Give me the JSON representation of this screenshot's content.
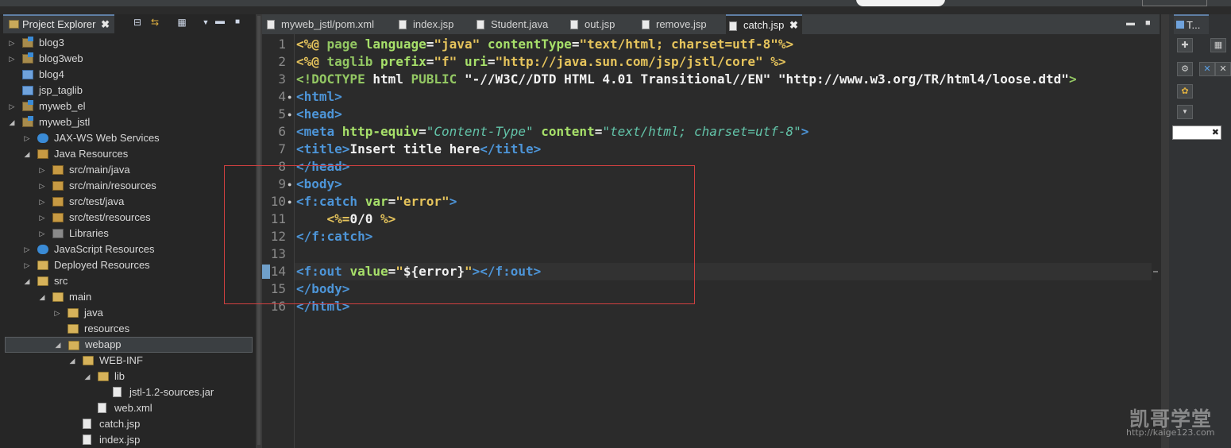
{
  "explorer": {
    "title": "Project Explorer",
    "close_glyph": "✖",
    "toolbar_icons": [
      "collapse-all-icon",
      "link-editor-icon",
      "view-menu-icon",
      "minimize-icon",
      "maximize-icon"
    ],
    "tree": [
      {
        "label": "blog3",
        "depth": 0,
        "arrow": "▷",
        "icon": "project"
      },
      {
        "label": "blog3web",
        "depth": 0,
        "arrow": "▷",
        "icon": "project"
      },
      {
        "label": "blog4",
        "depth": 0,
        "arrow": "",
        "icon": "folder-blue"
      },
      {
        "label": "jsp_taglib",
        "depth": 0,
        "arrow": "",
        "icon": "folder-blue"
      },
      {
        "label": "myweb_el",
        "depth": 0,
        "arrow": "▷",
        "icon": "project"
      },
      {
        "label": "myweb_jstl",
        "depth": 0,
        "arrow": "◢",
        "icon": "project"
      },
      {
        "label": "JAX-WS Web Services",
        "depth": 1,
        "arrow": "▷",
        "icon": "webservice"
      },
      {
        "label": "Java Resources",
        "depth": 1,
        "arrow": "◢",
        "icon": "package"
      },
      {
        "label": "src/main/java",
        "depth": 2,
        "arrow": "▷",
        "icon": "package"
      },
      {
        "label": "src/main/resources",
        "depth": 2,
        "arrow": "▷",
        "icon": "package"
      },
      {
        "label": "src/test/java",
        "depth": 2,
        "arrow": "▷",
        "icon": "package"
      },
      {
        "label": "src/test/resources",
        "depth": 2,
        "arrow": "▷",
        "icon": "package"
      },
      {
        "label": "Libraries",
        "depth": 2,
        "arrow": "▷",
        "icon": "library"
      },
      {
        "label": "JavaScript Resources",
        "depth": 1,
        "arrow": "▷",
        "icon": "webservice"
      },
      {
        "label": "Deployed Resources",
        "depth": 1,
        "arrow": "▷",
        "icon": "folder"
      },
      {
        "label": "src",
        "depth": 1,
        "arrow": "◢",
        "icon": "folder"
      },
      {
        "label": "main",
        "depth": 2,
        "arrow": "◢",
        "icon": "folder"
      },
      {
        "label": "java",
        "depth": 3,
        "arrow": "▷",
        "icon": "folder"
      },
      {
        "label": "resources",
        "depth": 3,
        "arrow": "",
        "icon": "folder"
      },
      {
        "label": "webapp",
        "depth": 3,
        "arrow": "◢",
        "icon": "folder",
        "selected": true
      },
      {
        "label": "WEB-INF",
        "depth": 4,
        "arrow": "◢",
        "icon": "folder"
      },
      {
        "label": "lib",
        "depth": 5,
        "arrow": "◢",
        "icon": "folder"
      },
      {
        "label": "jstl-1.2-sources.jar",
        "depth": 6,
        "arrow": "",
        "icon": "file"
      },
      {
        "label": "web.xml",
        "depth": 5,
        "arrow": "",
        "icon": "file"
      },
      {
        "label": "catch.jsp",
        "depth": 4,
        "arrow": "",
        "icon": "file"
      },
      {
        "label": "index.jsp",
        "depth": 4,
        "arrow": "",
        "icon": "file"
      }
    ]
  },
  "editor": {
    "tabs": [
      {
        "label": "myweb_jstl/pom.xml",
        "active": false
      },
      {
        "label": "index.jsp",
        "active": false
      },
      {
        "label": "Student.java",
        "active": false
      },
      {
        "label": "out.jsp",
        "active": false
      },
      {
        "label": "remove.jsp",
        "active": false
      },
      {
        "label": "catch.jsp",
        "active": true
      }
    ],
    "close_glyph": "✖",
    "minimize_glyph": "▬",
    "maximize_glyph": "■",
    "current_line": 14,
    "lines": [
      {
        "n": "1",
        "tokens": [
          [
            "c-dir",
            "<%@ "
          ],
          [
            "c-kw",
            "page "
          ],
          [
            "c-attr",
            "language"
          ],
          [
            "c-text",
            "="
          ],
          [
            "c-str",
            "\"java\" "
          ],
          [
            "c-attr",
            "contentType"
          ],
          [
            "c-text",
            "="
          ],
          [
            "c-str",
            "\"text/html; charset=utf-8\""
          ],
          [
            "c-dir",
            "%>"
          ]
        ]
      },
      {
        "n": "2",
        "tokens": [
          [
            "c-dir",
            "<%@ "
          ],
          [
            "c-kw",
            "taglib "
          ],
          [
            "c-attr",
            "prefix"
          ],
          [
            "c-text",
            "="
          ],
          [
            "c-str",
            "\"f\" "
          ],
          [
            "c-attr",
            "uri"
          ],
          [
            "c-text",
            "="
          ],
          [
            "c-str",
            "\"http://java.sun.com/jsp/jstl/core\" "
          ],
          [
            "c-dir",
            "%>"
          ]
        ]
      },
      {
        "n": "3",
        "tokens": [
          [
            "c-kw",
            "<!DOCTYPE "
          ],
          [
            "c-doc",
            "html "
          ],
          [
            "c-kw",
            "PUBLIC "
          ],
          [
            "c-dstr",
            "\"-//W3C//DTD HTML 4.01 Transitional//EN\" "
          ],
          [
            "c-dstr",
            "\"http://www.w3.org/TR/html4/loose.dtd\""
          ],
          [
            "c-kw",
            ">"
          ]
        ]
      },
      {
        "n": "4",
        "fold": true,
        "tokens": [
          [
            "c-tag",
            "<html>"
          ]
        ]
      },
      {
        "n": "5",
        "fold": true,
        "tokens": [
          [
            "c-tag",
            "<head>"
          ]
        ]
      },
      {
        "n": "6",
        "tokens": [
          [
            "c-tag",
            "<meta "
          ],
          [
            "c-attr",
            "http-equiv"
          ],
          [
            "c-text",
            "="
          ],
          [
            "c-ital",
            "\"Content-Type\" "
          ],
          [
            "c-attr",
            "content"
          ],
          [
            "c-text",
            "="
          ],
          [
            "c-ital",
            "\"text/html; charset=utf-8\""
          ],
          [
            "c-tag",
            ">"
          ]
        ]
      },
      {
        "n": "7",
        "tokens": [
          [
            "c-tag",
            "<title>"
          ],
          [
            "c-text",
            "Insert title here"
          ],
          [
            "c-tag",
            "</title>"
          ]
        ]
      },
      {
        "n": "8",
        "tokens": [
          [
            "c-tag",
            "</head>"
          ]
        ]
      },
      {
        "n": "9",
        "fold": true,
        "tokens": [
          [
            "c-tag",
            "<body>"
          ]
        ]
      },
      {
        "n": "10",
        "fold": true,
        "tokens": [
          [
            "c-tag",
            "<f:catch "
          ],
          [
            "c-attr",
            "var"
          ],
          [
            "c-text",
            "="
          ],
          [
            "c-str",
            "\"error\""
          ],
          [
            "c-tag",
            ">"
          ]
        ]
      },
      {
        "n": "11",
        "tokens": [
          [
            "c-text",
            "    "
          ],
          [
            "c-dir",
            "<%="
          ],
          [
            "c-text",
            "0/0 "
          ],
          [
            "c-dir",
            "%>"
          ]
        ]
      },
      {
        "n": "12",
        "tokens": [
          [
            "c-tag",
            "</f:catch>"
          ]
        ]
      },
      {
        "n": "13",
        "tokens": []
      },
      {
        "n": "14",
        "bookmark": true,
        "tokens": [
          [
            "c-tag",
            "<f:out "
          ],
          [
            "c-attr",
            "value"
          ],
          [
            "c-text",
            "="
          ],
          [
            "c-str",
            "\""
          ],
          [
            "c-text",
            "${error}"
          ],
          [
            "c-str",
            "\""
          ],
          [
            "c-tag",
            "></f:out>"
          ]
        ]
      },
      {
        "n": "15",
        "tokens": [
          [
            "c-tag",
            "</body>"
          ]
        ]
      },
      {
        "n": "16",
        "tokens": [
          [
            "c-tag",
            "</html>"
          ]
        ]
      }
    ]
  },
  "right_panel": {
    "tab_label": "T..."
  },
  "watermark": {
    "logo": "凯哥学堂",
    "url": "http://kaige123.com"
  }
}
